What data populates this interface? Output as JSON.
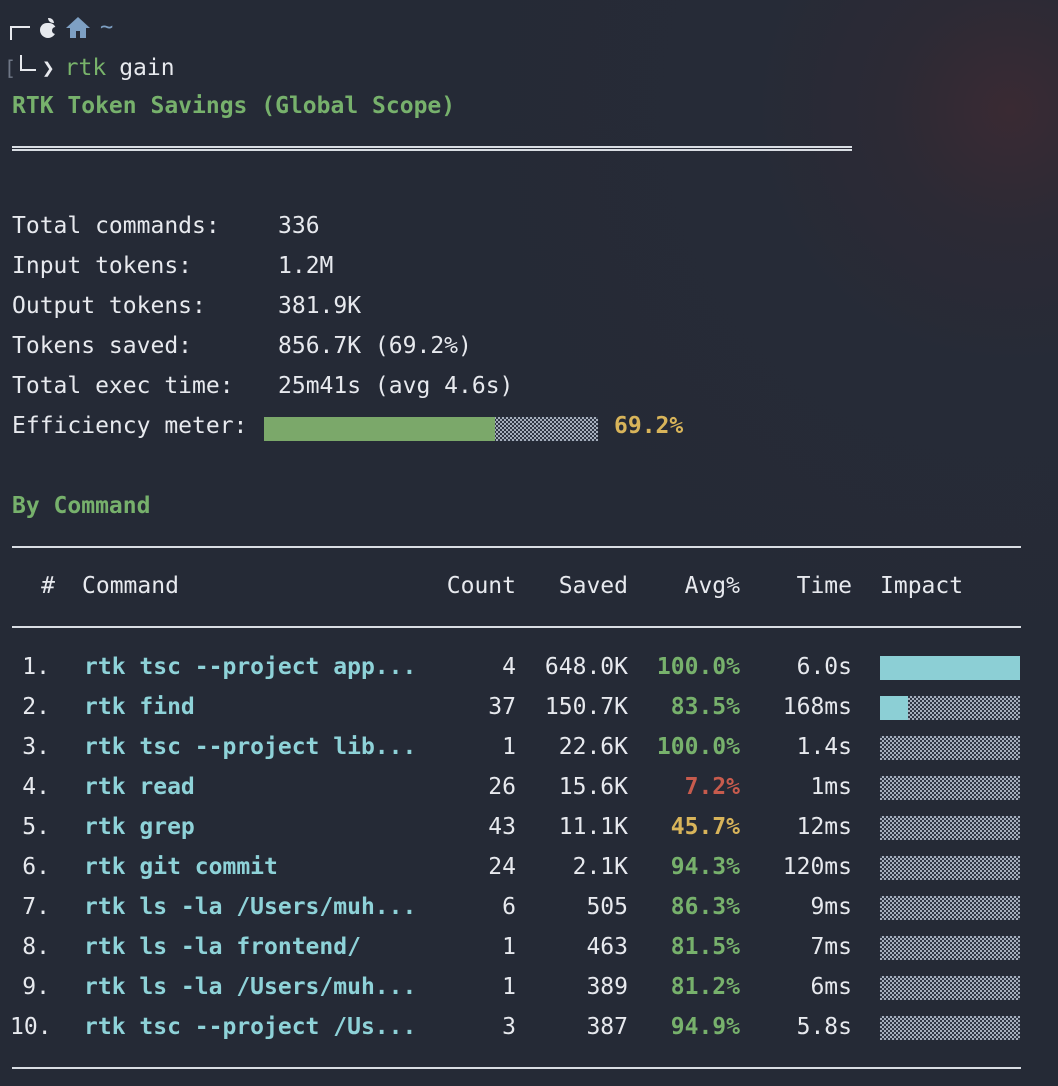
{
  "prompt": {
    "path": "~",
    "apple_icon": "apple-icon",
    "home_icon": "home-icon",
    "bracket": "[",
    "arrow": "❯",
    "command": "rtk",
    "argument": "gain"
  },
  "report": {
    "title": "RTK Token Savings (Global Scope)",
    "summary": [
      {
        "label": "Total commands:",
        "value": "336"
      },
      {
        "label": "Input tokens:",
        "value": "1.2M"
      },
      {
        "label": "Output tokens:",
        "value": "381.9K"
      },
      {
        "label": "Tokens saved:",
        "value": "856.7K (69.2%)"
      },
      {
        "label": "Total exec time:",
        "value": "25m41s (avg 4.6s)"
      }
    ],
    "efficiency": {
      "label": "Efficiency meter:",
      "value": 0.692,
      "text": "69.2%"
    }
  },
  "by_command": {
    "title": "By Command",
    "columns": {
      "num": "#",
      "command": "Command",
      "count": "Count",
      "saved": "Saved",
      "avg": "Avg%",
      "time": "Time",
      "impact": "Impact"
    },
    "rows": [
      {
        "num": "1.",
        "command": "rtk tsc --project app...",
        "count": "4",
        "saved": "648.0K",
        "avg": "100.0%",
        "time": "6.0s",
        "impact": 1.0
      },
      {
        "num": "2.",
        "command": "rtk find",
        "count": "37",
        "saved": "150.7K",
        "avg": "83.5%",
        "time": "168ms",
        "impact": 0.2
      },
      {
        "num": "3.",
        "command": "rtk tsc --project lib...",
        "count": "1",
        "saved": "22.6K",
        "avg": "100.0%",
        "time": "1.4s",
        "impact": 0.0
      },
      {
        "num": "4.",
        "command": "rtk read",
        "count": "26",
        "saved": "15.6K",
        "avg": "7.2%",
        "time": "1ms",
        "impact": 0.0
      },
      {
        "num": "5.",
        "command": "rtk grep",
        "count": "43",
        "saved": "11.1K",
        "avg": "45.7%",
        "time": "12ms",
        "impact": 0.0
      },
      {
        "num": "6.",
        "command": "rtk git commit",
        "count": "24",
        "saved": "2.1K",
        "avg": "94.3%",
        "time": "120ms",
        "impact": 0.0
      },
      {
        "num": "7.",
        "command": "rtk ls -la /Users/muh...",
        "count": "6",
        "saved": "505",
        "avg": "86.3%",
        "time": "9ms",
        "impact": 0.0
      },
      {
        "num": "8.",
        "command": "rtk ls -la frontend/",
        "count": "1",
        "saved": "463",
        "avg": "81.5%",
        "time": "7ms",
        "impact": 0.0
      },
      {
        "num": "9.",
        "command": "rtk ls -la /Users/muh...",
        "count": "1",
        "saved": "389",
        "avg": "81.2%",
        "time": "6ms",
        "impact": 0.0
      },
      {
        "num": "10.",
        "command": "rtk tsc --project /Us...",
        "count": "3",
        "saved": "387",
        "avg": "94.9%",
        "time": "5.8s",
        "impact": 0.0
      }
    ]
  },
  "colors": {
    "green": "#77b16c",
    "cyan": "#8ed2d8",
    "yellow": "#d8b45a",
    "red": "#c75b4d",
    "text": "#e7e9ee"
  }
}
